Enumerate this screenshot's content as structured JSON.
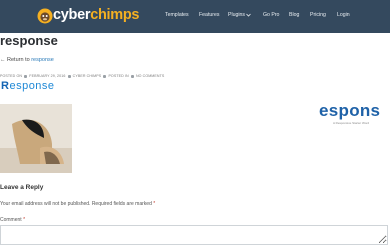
{
  "header": {
    "brand": {
      "prefix": "cyber",
      "suffix": "chimps"
    },
    "nav": [
      {
        "label": "Templates"
      },
      {
        "label": "Features"
      },
      {
        "label": "Plugins",
        "has_dropdown": true
      },
      {
        "label": "Go Pro"
      },
      {
        "label": "Blog"
      },
      {
        "label": "Pricing"
      },
      {
        "label": "Login"
      }
    ],
    "colors": {
      "background": "#34495e",
      "brand_accent": "#f5b021"
    }
  },
  "post": {
    "title": "response",
    "return_prefix": "← Return to",
    "return_link": "response",
    "meta": {
      "posted_on": "POSTED ON",
      "date": "FEBRUARY 29, 2016",
      "author": "CYBER CHIMPS",
      "posted_in": "POSTED IN",
      "comments": "NO COMMENTS"
    },
    "wordmark": {
      "initial": "R",
      "rest": "esponse"
    },
    "screenshot_brand": {
      "text": "espons",
      "tagline": "A Responsive Starter Word"
    }
  },
  "comments": {
    "heading": "Leave a Reply",
    "notes_text": "Your email address will not be published. Required fields are marked",
    "required_mark": "*",
    "comment_label": "Comment",
    "comment_value": ""
  }
}
